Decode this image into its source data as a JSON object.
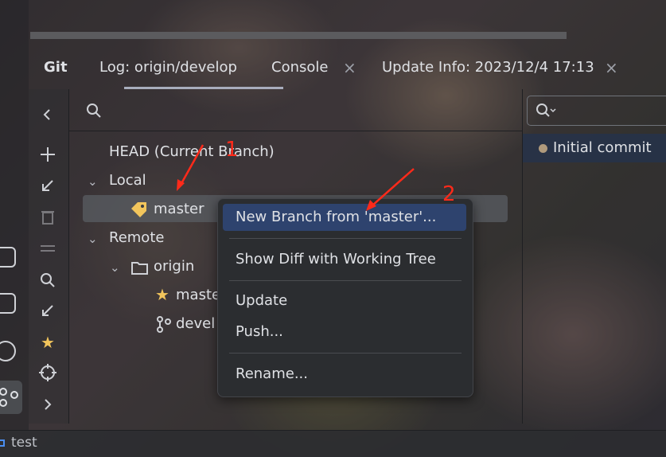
{
  "tool_window": {
    "title": "Git"
  },
  "tabs": [
    {
      "label": "Log: origin/develop",
      "active": true,
      "closable": false
    },
    {
      "label": "Console",
      "active": false,
      "closable": true
    },
    {
      "label": "Update Info: 2023/12/4 17:13",
      "active": false,
      "closable": true
    }
  ],
  "tab_close_glyph": "×",
  "branch_tree": {
    "head": "HEAD (Current Branch)",
    "local_group": "Local",
    "local_branches": [
      "master"
    ],
    "remote_group": "Remote",
    "remote_origin": "origin",
    "remote_branches": [
      "maste",
      "devel"
    ]
  },
  "commit_list": {
    "items": [
      "Initial commit"
    ]
  },
  "context_menu": {
    "items": [
      "New Branch from 'master'...",
      "Show Diff with Working Tree",
      "Update",
      "Push...",
      "Rename..."
    ]
  },
  "status_bar": {
    "project": "test"
  },
  "annotations": {
    "first": "1",
    "second": "2"
  },
  "colors": {
    "selection": "#2e436e",
    "annotation_red": "#ff2a1a",
    "star": "#f2c55c",
    "tag": "#f2c55c"
  }
}
